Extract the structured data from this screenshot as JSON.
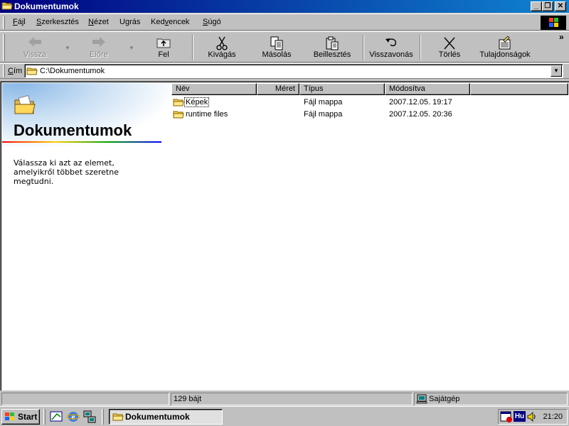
{
  "window": {
    "title": "Dokumentumok",
    "controls": {
      "minimize": "_",
      "restore": "❐",
      "close": "✕"
    }
  },
  "menu": {
    "items": [
      {
        "pre": "",
        "u": "F",
        "post": "ájl"
      },
      {
        "pre": "",
        "u": "S",
        "post": "zerkesztés"
      },
      {
        "pre": "",
        "u": "N",
        "post": "ézet"
      },
      {
        "pre": "U",
        "u": "g",
        "post": "rás"
      },
      {
        "pre": "Ked",
        "u": "v",
        "post": "encek"
      },
      {
        "pre": "",
        "u": "S",
        "post": "úgó"
      }
    ]
  },
  "toolbar": {
    "back": "Vissza",
    "forward": "Előre",
    "up": "Fel",
    "cut": "Kivágás",
    "copy": "Másolás",
    "paste": "Beillesztés",
    "undo": "Visszavonás",
    "delete": "Törlés",
    "properties": "Tulajdonságok",
    "chevron": "»"
  },
  "address": {
    "label_u": "C",
    "label_rest": "ím",
    "value": "C:\\Dokumentumok"
  },
  "left_panel": {
    "title": "Dokumentumok",
    "description": "Válassza ki azt az elemet, amelyikről többet szeretne megtudni."
  },
  "list": {
    "columns": [
      "Név",
      "Méret",
      "Típus",
      "Módosítva"
    ],
    "rows": [
      {
        "name": "Képek",
        "size": "",
        "type": "Fájl mappa",
        "modified": "2007.12.05. 19:17"
      },
      {
        "name": "runtime files",
        "size": "",
        "type": "Fájl mappa",
        "modified": "2007.12.05. 20:36"
      }
    ]
  },
  "status": {
    "size": "129 bájt",
    "zone": "Sajátgép"
  },
  "taskbar": {
    "start": "Start",
    "active_task": "Dokumentumok",
    "language": "Hu",
    "clock": "21:20"
  },
  "icons": {
    "folder": "folder-icon",
    "back": "arrow-left-icon",
    "forward": "arrow-right-icon",
    "up": "folder-up-icon",
    "cut": "scissors-icon",
    "copy": "copy-icon",
    "paste": "paste-icon",
    "undo": "undo-icon",
    "delete": "delete-x-icon",
    "properties": "properties-icon",
    "computer": "computer-icon"
  },
  "colors": {
    "titlebar_start": "#000080",
    "titlebar_end": "#1084d0",
    "face": "#c0c0c0"
  }
}
